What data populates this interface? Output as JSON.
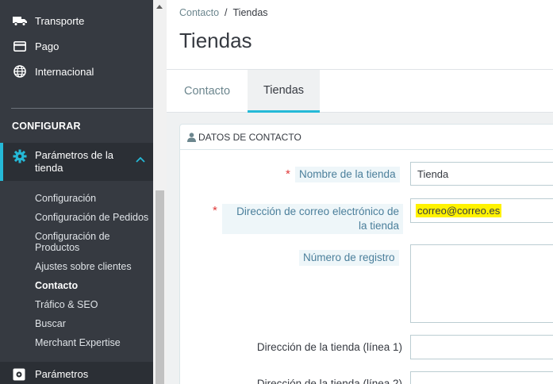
{
  "sidebar": {
    "top_items": [
      {
        "label": "Transporte",
        "icon": "truck-icon"
      },
      {
        "label": "Pago",
        "icon": "credit-card-icon"
      },
      {
        "label": "Internacional",
        "icon": "globe-icon"
      }
    ],
    "section_title": "CONFIGURAR",
    "active_item": {
      "label": "Parámetros de la tienda",
      "icon": "gear-icon"
    },
    "sub_items": [
      "Configuración",
      "Configuración de Pedidos",
      "Configuración de Productos",
      "Ajustes sobre clientes",
      "Contacto",
      "Tráfico & SEO",
      "Buscar",
      "Merchant Expertise"
    ],
    "bottom_item": {
      "label": "Parámetros",
      "icon": "cog-box-icon"
    }
  },
  "header": {
    "breadcrumb": {
      "parent": "Contacto",
      "separator": "/",
      "current": "Tiendas"
    },
    "title": "Tiendas"
  },
  "tabs": [
    {
      "label": "Contacto",
      "active": false
    },
    {
      "label": "Tiendas",
      "active": true
    }
  ],
  "panel": {
    "title": "DATOS DE CONTACTO",
    "icon": "user-icon",
    "fields": {
      "store_name": {
        "label": "Nombre de la tienda",
        "required": true,
        "value": "Tienda"
      },
      "email": {
        "label": "Dirección de correo electrónico de la tienda",
        "required": true,
        "value": "correo@correo.es"
      },
      "registration": {
        "label": "Número de registro",
        "required": false,
        "value": ""
      },
      "address1": {
        "label": "Dirección de la tienda (línea 1)",
        "value": ""
      },
      "address2": {
        "label": "Dirección de la tienda (línea 2)",
        "value": ""
      }
    },
    "required_mark": "*"
  },
  "colors": {
    "sidebar_bg": "#363a41",
    "accent": "#25b9d7",
    "required": "#e03a3a",
    "highlight": "#fff200"
  }
}
